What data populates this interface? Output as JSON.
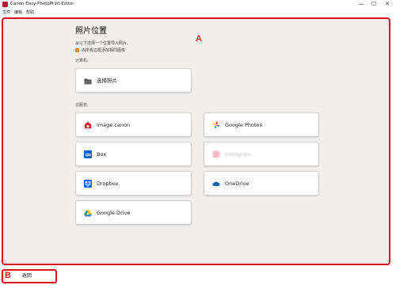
{
  "window": {
    "title": "Canon Easy-PhotoPrint Editor",
    "controls": {
      "minimize": "—",
      "maximize": "☐",
      "close": "✕"
    }
  },
  "menu": [
    "文件",
    "编辑",
    "帮助"
  ],
  "callouts": {
    "a": "A",
    "b": "B"
  },
  "page": {
    "title": "照片位置",
    "subtitle": "从以下选择一个位置导入照片。",
    "checkbox_label": "向所有边框添加相同图像",
    "checkbox_checked": true,
    "computer_section": "计算机:",
    "cloud_section": "云服务:"
  },
  "computer_cards": [
    {
      "label": "选择照片",
      "icon": "folder-icon"
    }
  ],
  "cloud_cards": [
    {
      "label": "image.canon",
      "icon": "image-canon-icon"
    },
    {
      "label": "Google Photos",
      "icon": "google-photos-icon"
    },
    {
      "label": "Box",
      "icon": "box-icon"
    },
    {
      "label": "Instagram",
      "icon": "instagram-icon",
      "blurred": true
    },
    {
      "label": "Dropbox",
      "icon": "dropbox-icon"
    },
    {
      "label": "OneDrive",
      "icon": "onedrive-icon"
    },
    {
      "label": "Google Drive",
      "icon": "google-drive-icon"
    }
  ],
  "footer": {
    "back_label": "返回"
  },
  "colors": {
    "accent": "#e0151c",
    "checkbox": "#e8861d",
    "background": "#f1efee"
  }
}
